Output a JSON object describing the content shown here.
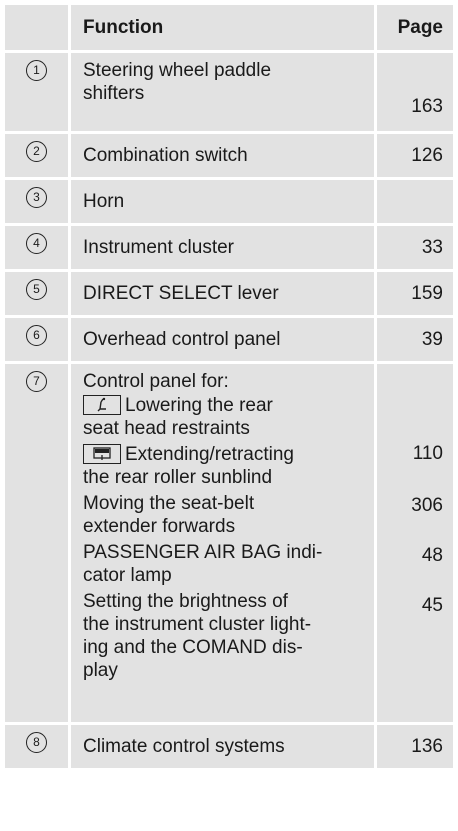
{
  "header": {
    "function": "Function",
    "page": "Page"
  },
  "rows": [
    {
      "num": "1",
      "text": "Steering wheel paddle shifters",
      "line1": "Steering wheel paddle",
      "line2": "shifters",
      "page": "163"
    },
    {
      "num": "2",
      "text": "Combination switch",
      "page": "126"
    },
    {
      "num": "3",
      "text": "Horn",
      "page": ""
    },
    {
      "num": "4",
      "text": "Instrument cluster",
      "page": "33"
    },
    {
      "num": "5",
      "text": "DIRECT SELECT lever",
      "page": "159"
    },
    {
      "num": "6",
      "text": "Overhead control panel",
      "page": "39"
    },
    {
      "num": "7",
      "intro": "Control panel for:",
      "items": [
        {
          "icon": "seat-head-restraint-icon",
          "l1": "Lowering the rear",
          "l2": "seat head restraints",
          "page": "110"
        },
        {
          "icon": "roller-sunblind-icon",
          "l1": "Extending/retracting",
          "l2": "the rear roller sunblind",
          "page": "306"
        },
        {
          "l1": "Moving the seat-belt",
          "l2": "extender forwards",
          "page": "48"
        },
        {
          "l1": "PASSENGER AIR BAG indi-",
          "l2": "cator lamp",
          "page": "45"
        },
        {
          "l1": "Setting the brightness of",
          "l2": "the instrument cluster light-",
          "l3": "ing and the COMAND dis-",
          "l4": "play",
          "page": ""
        }
      ]
    },
    {
      "num": "8",
      "text": "Climate control systems",
      "page": "136"
    }
  ]
}
